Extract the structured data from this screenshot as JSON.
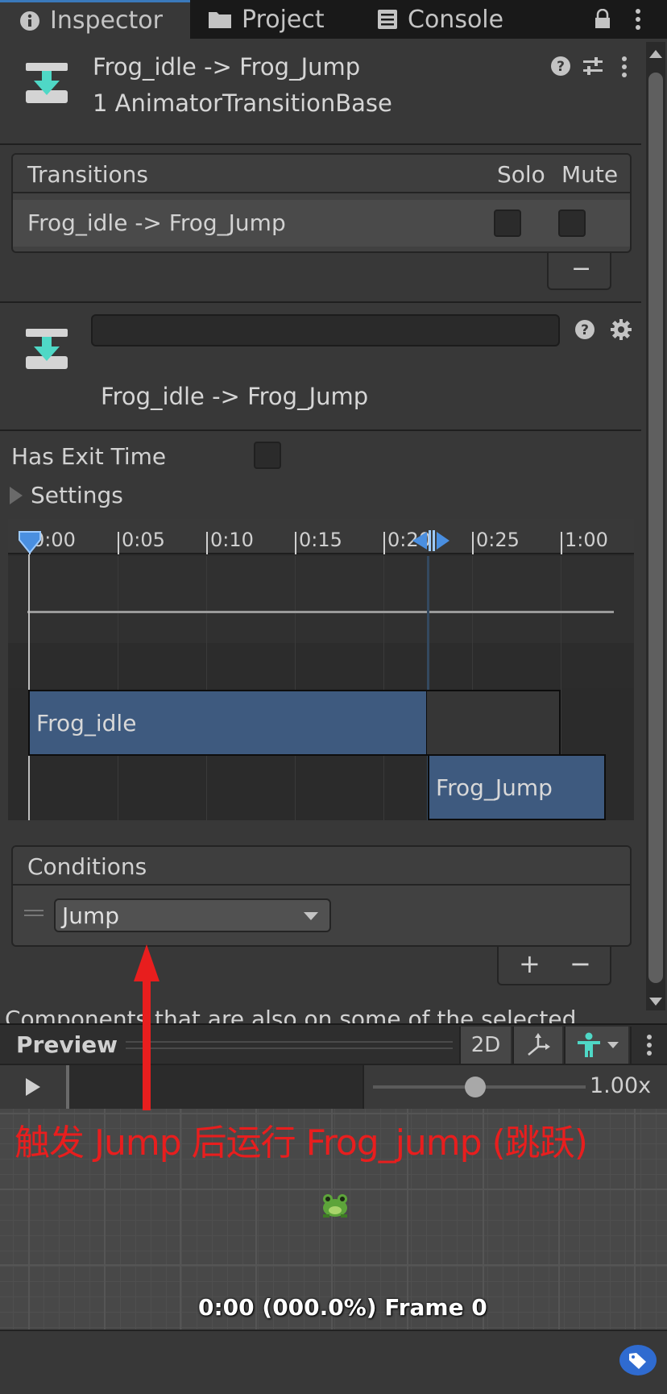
{
  "tabs": {
    "inspector": "Inspector",
    "project": "Project",
    "console": "Console"
  },
  "header": {
    "title": "Frog_idle -> Frog_Jump",
    "subtitle": "1 AnimatorTransitionBase"
  },
  "transitions": {
    "header": "Transitions",
    "solo": "Solo",
    "mute": "Mute",
    "row_label": "Frog_idle -> Frog_Jump",
    "remove_label": "−"
  },
  "transition_detail": {
    "name_value": "",
    "label": "Frog_idle -> Frog_Jump"
  },
  "has_exit_time": {
    "label": "Has Exit Time",
    "checked": false
  },
  "settings_label": "Settings",
  "timeline": {
    "ticks": [
      "0:00",
      "0:05",
      "0:10",
      "0:15",
      "0:20",
      "0:25",
      "1:00"
    ],
    "clip_from": "Frog_idle",
    "clip_to": "Frog_Jump"
  },
  "conditions": {
    "header": "Conditions",
    "parameter": "Jump",
    "add_label": "+",
    "remove_label": "−"
  },
  "cut_text": "Components that are also on some of the selected...",
  "preview": {
    "title": "Preview",
    "mode_2d": "2D",
    "speed": "1.00x",
    "frame_info": "0:00 (000.0%) Frame 0"
  },
  "annotation": "触发 Jump 后运行 Frog_jump (跳跃)",
  "colors": {
    "accent": "#3a79bb",
    "clip_blue": "#3e5a7f",
    "annotation_red": "#e81e1e",
    "teal_icon": "#4fd8c6"
  }
}
